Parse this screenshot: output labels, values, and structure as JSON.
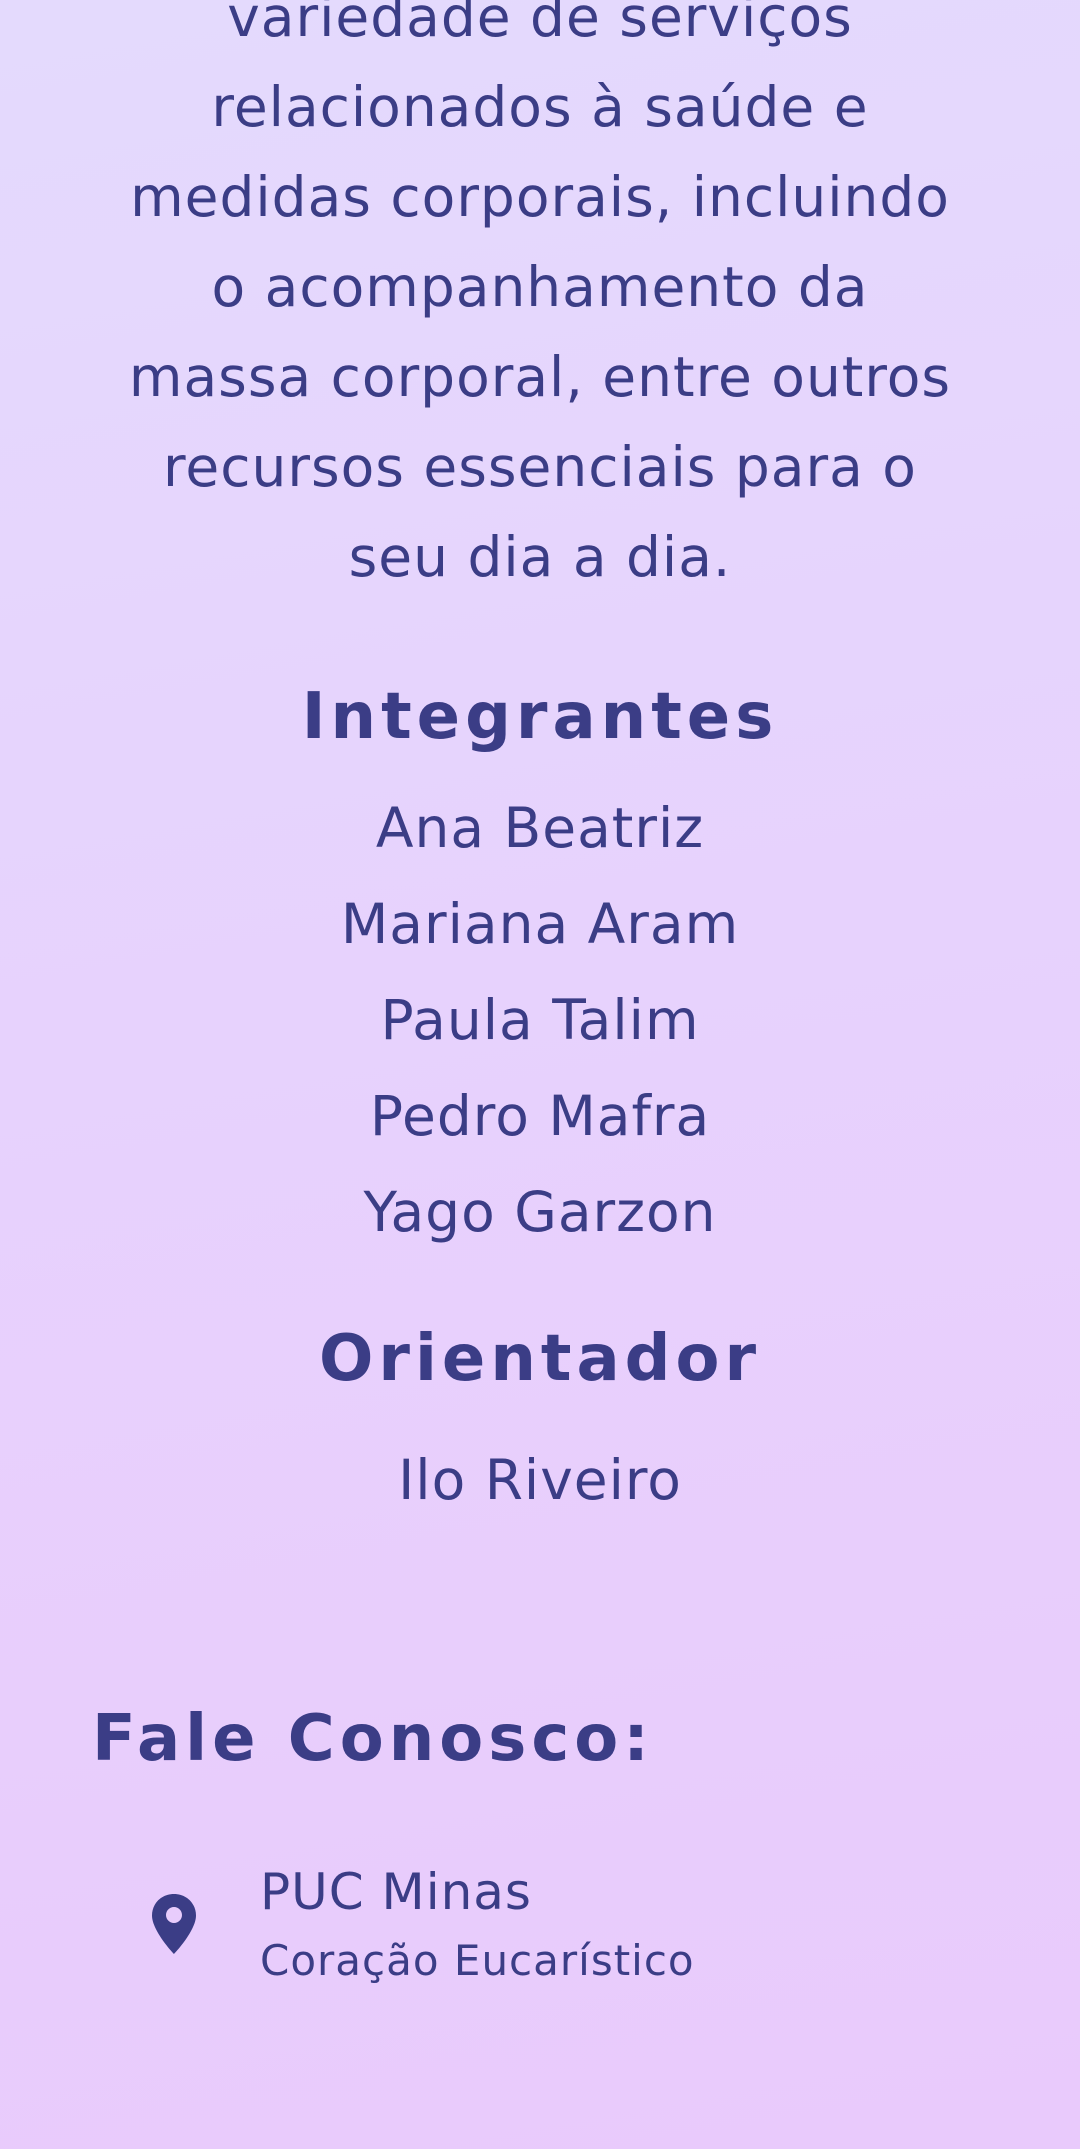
{
  "about": {
    "lines": [
      "variedade de serviços",
      "relacionados à saúde e",
      "medidas corporais, incluindo",
      "o acompanhamento da",
      "massa corporal, entre outros",
      "recursos essenciais para o",
      "seu dia a dia."
    ]
  },
  "members": {
    "heading": "Integrantes",
    "names": [
      "Ana Beatriz",
      "Mariana Aram",
      "Paula Talim",
      "Pedro Mafra",
      "Yago Garzon"
    ]
  },
  "advisor": {
    "heading": "Orientador",
    "name": "Ilo Riveiro"
  },
  "contact": {
    "heading": "Fale Conosco:",
    "location": {
      "icon": "map-pin-icon",
      "title": "PUC Minas",
      "subtitle": "Coração Eucarístico"
    }
  },
  "colors": {
    "text": "#3b3d86",
    "background_top": "#e4dafd",
    "background_bottom": "#e9cafc"
  }
}
